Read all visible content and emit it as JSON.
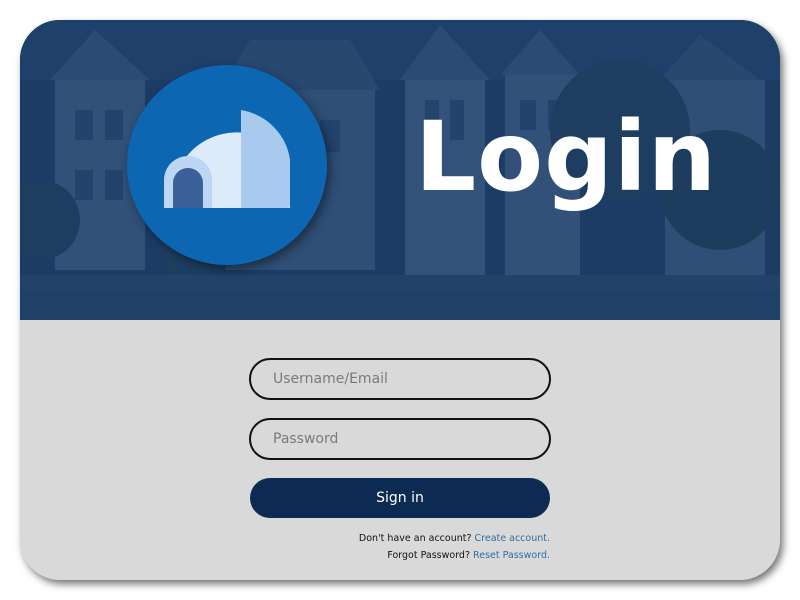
{
  "hero": {
    "title": "Login",
    "logo_icon": "igloo-icon",
    "background": "houses-street-photo"
  },
  "form": {
    "username_placeholder": "Username/Email",
    "password_placeholder": "Password",
    "signin_label": "Sign in"
  },
  "links": {
    "signup_prompt": "Don't have an account?",
    "signup_link": "Create account.",
    "reset_prompt": "Forgot Password?",
    "reset_link": "Reset Password."
  },
  "colors": {
    "hero_tint": "#1f3a5e",
    "logo_circle": "#0c66b2",
    "button": "#0d2b52",
    "panel": "#d9d9d9",
    "link": "#2e6da4"
  }
}
